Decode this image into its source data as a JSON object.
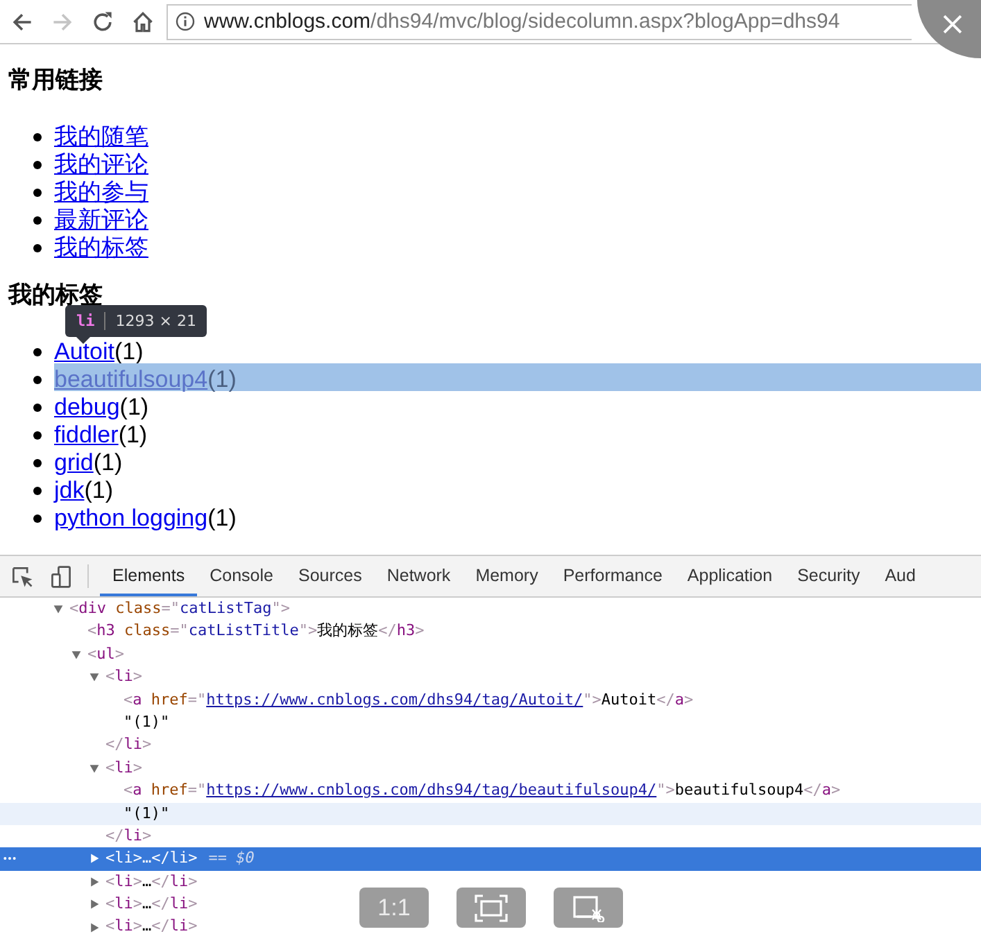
{
  "browser": {
    "nav": [
      {
        "kind": "back",
        "disabled": false
      },
      {
        "kind": "forward",
        "disabled": true
      },
      {
        "kind": "reload",
        "disabled": false
      },
      {
        "kind": "home",
        "disabled": false
      }
    ],
    "address": {
      "host": "www.cnblogs.com",
      "path": "/dhs94/mvc/blog/sidecolumn.aspx?blogApp=dhs94"
    }
  },
  "page": {
    "sections": [
      {
        "title": "常用链接",
        "items": [
          {
            "label": "我的随笔",
            "highlighted": false
          },
          {
            "label": "我的评论",
            "highlighted": false
          },
          {
            "label": "我的参与",
            "highlighted": false
          },
          {
            "label": "最新评论",
            "highlighted": false
          },
          {
            "label": "我的标签",
            "highlighted": false
          }
        ]
      },
      {
        "title": "我的标签",
        "items": [
          {
            "label": "Autoit",
            "count": "(1)",
            "highlighted": false
          },
          {
            "label": "beautifulsoup4",
            "count": "(1)",
            "highlighted": true
          },
          {
            "label": "debug",
            "count": "(1)",
            "highlighted": false
          },
          {
            "label": "fiddler",
            "count": "(1)",
            "highlighted": false
          },
          {
            "label": "grid",
            "count": "(1)",
            "highlighted": false
          },
          {
            "label": "jdk",
            "count": "(1)",
            "highlighted": false
          },
          {
            "label": "python logging",
            "count": "(1)",
            "highlighted": false
          }
        ]
      }
    ],
    "tooltip": {
      "tag": "li",
      "size": "1293 × 21"
    }
  },
  "devtools": {
    "tabs": [
      {
        "label": "Elements",
        "selected": true
      },
      {
        "label": "Console",
        "selected": false
      },
      {
        "label": "Sources",
        "selected": false
      },
      {
        "label": "Network",
        "selected": false
      },
      {
        "label": "Memory",
        "selected": false
      },
      {
        "label": "Performance",
        "selected": false
      },
      {
        "label": "Application",
        "selected": false
      },
      {
        "label": "Security",
        "selected": false
      },
      {
        "label": "Aud",
        "selected": false
      }
    ],
    "tree": [
      {
        "text": "<div class=\"catListTag\">",
        "expanded": true,
        "selected": false,
        "hovered": false,
        "children": [
          {
            "text": "<h3 class=\"catListTitle\">我的标签</h3>",
            "selected": false,
            "hovered": false
          },
          {
            "text": "<ul>",
            "expanded": true,
            "selected": false,
            "hovered": false,
            "children": [
              {
                "text": "<li>",
                "expanded": true,
                "selected": false,
                "hovered": false,
                "close": "</li>",
                "children": [
                  {
                    "text": "<a href=\"https://www.cnblogs.com/dhs94/tag/Autoit/\">Autoit</a>",
                    "selected": false,
                    "hovered": false
                  },
                  {
                    "text": "\"(1)\"",
                    "selected": false,
                    "hovered": false
                  }
                ]
              },
              {
                "text": "<li>",
                "expanded": true,
                "selected": false,
                "hovered": false,
                "close": "</li>",
                "children": [
                  {
                    "text": "<a href=\"https://www.cnblogs.com/dhs94/tag/beautifulsoup4/\">beautifulsoup4</a>",
                    "selected": false,
                    "hovered": false
                  },
                  {
                    "text": "\"(1)\"",
                    "selected": false,
                    "hovered": true
                  }
                ]
              },
              {
                "text": "<li>…</li>",
                "suffix": "== $0",
                "expanded": false,
                "selected": true,
                "hovered": false
              },
              {
                "text": "<li>…</li>",
                "expanded": false,
                "selected": false,
                "hovered": false
              },
              {
                "text": "<li>…</li>",
                "expanded": false,
                "selected": false,
                "hovered": false
              },
              {
                "text": "<li>…</li>",
                "expanded": false,
                "selected": false,
                "hovered": false
              }
            ]
          }
        ]
      }
    ],
    "overlay_buttons": [
      {
        "kind": "ratio",
        "label": "1:1",
        "disabled": true
      },
      {
        "kind": "fit",
        "disabled": false
      },
      {
        "kind": "screenshot",
        "disabled": false
      }
    ]
  }
}
